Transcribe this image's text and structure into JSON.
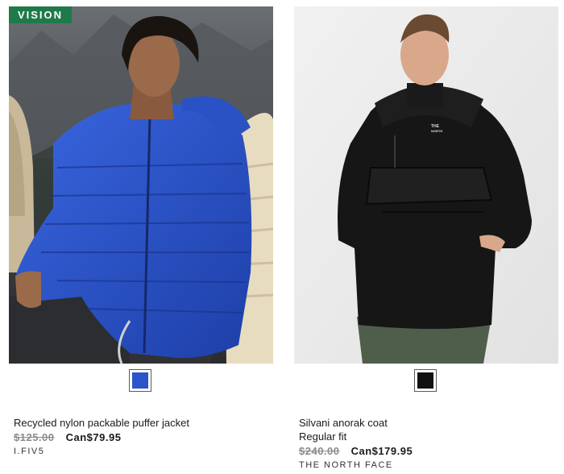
{
  "products": [
    {
      "badge": "VISION",
      "title": "Recycled nylon packable puffer jacket",
      "fit": "",
      "old_price": "$125.00",
      "new_price": "Can$79.95",
      "brand": "I.FIV5",
      "swatch_color": "#2a55c8"
    },
    {
      "badge": "",
      "title": "Silvani anorak coat",
      "fit": "Regular fit",
      "old_price": "$240.00",
      "new_price": "Can$179.95",
      "brand": "THE NORTH FACE",
      "swatch_color": "#111111"
    }
  ],
  "colors": {
    "badge_bg": "#1f7a4a",
    "old_price": "#8a8a8a"
  }
}
